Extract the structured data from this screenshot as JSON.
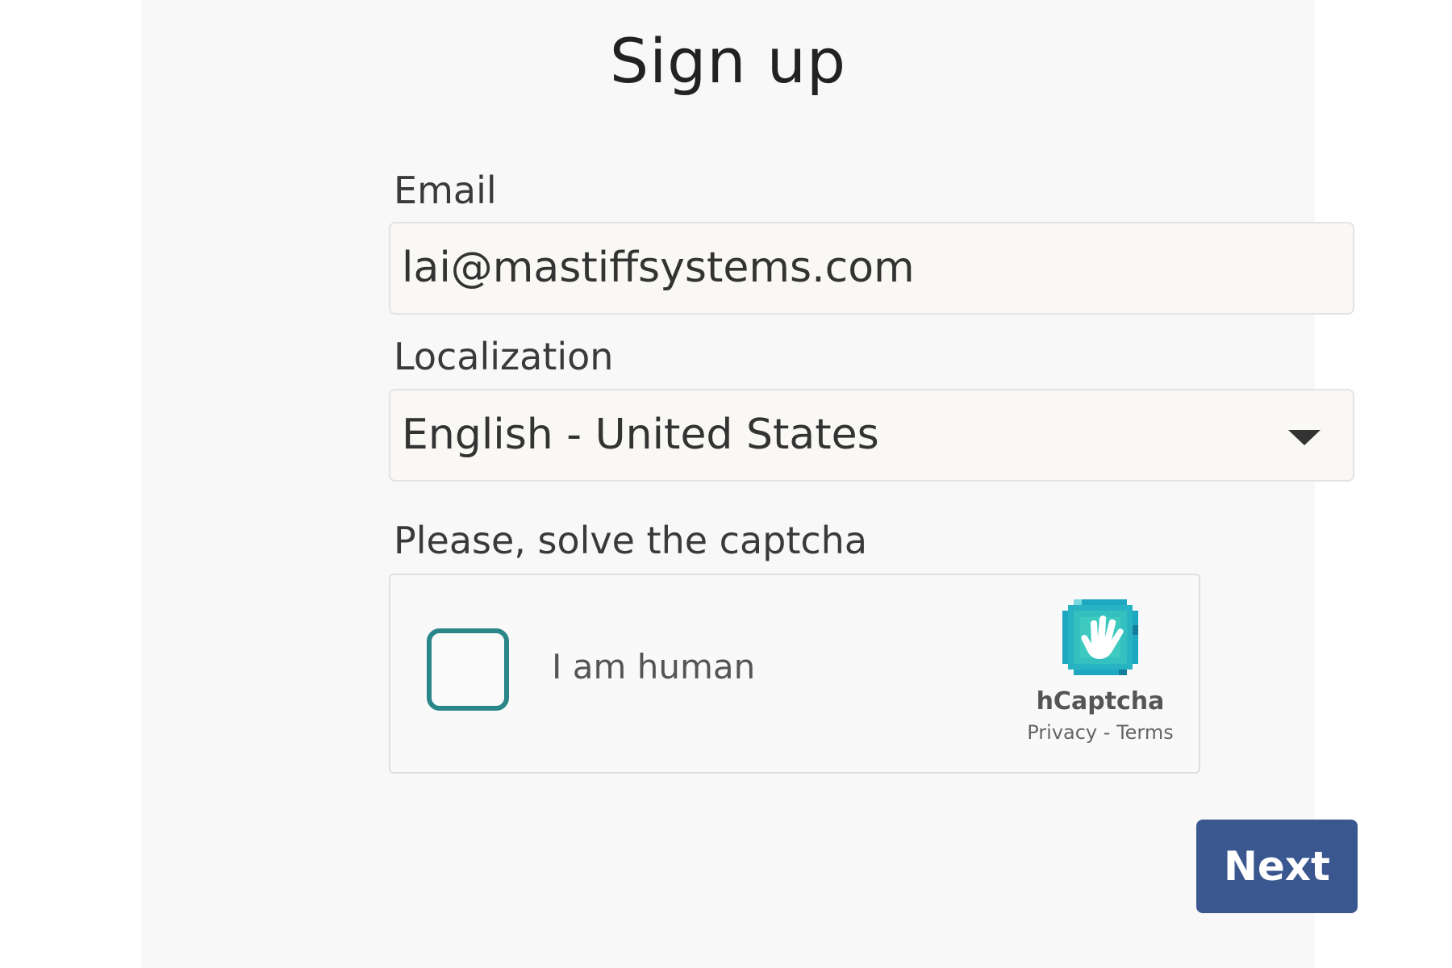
{
  "page": {
    "title": "Sign up"
  },
  "form": {
    "email_label": "Email",
    "email_value": "lai@mastiffsystems.com",
    "localization_label": "Localization",
    "localization_value": "English - United States",
    "captcha_label": "Please, solve the captcha",
    "next_label": "Next"
  },
  "captcha": {
    "checkbox_text": "I am human",
    "checked": false,
    "brand": "hCaptcha",
    "privacy_link": "Privacy",
    "separator": " - ",
    "terms_link": "Terms",
    "logo_icon": "hand-icon",
    "logo_color": "#2bb5c5",
    "checkbox_color": "#2a8689"
  },
  "colors": {
    "panel_background": "#f8f8f8",
    "button_background": "#3b5790",
    "button_text": "#ffffff"
  }
}
